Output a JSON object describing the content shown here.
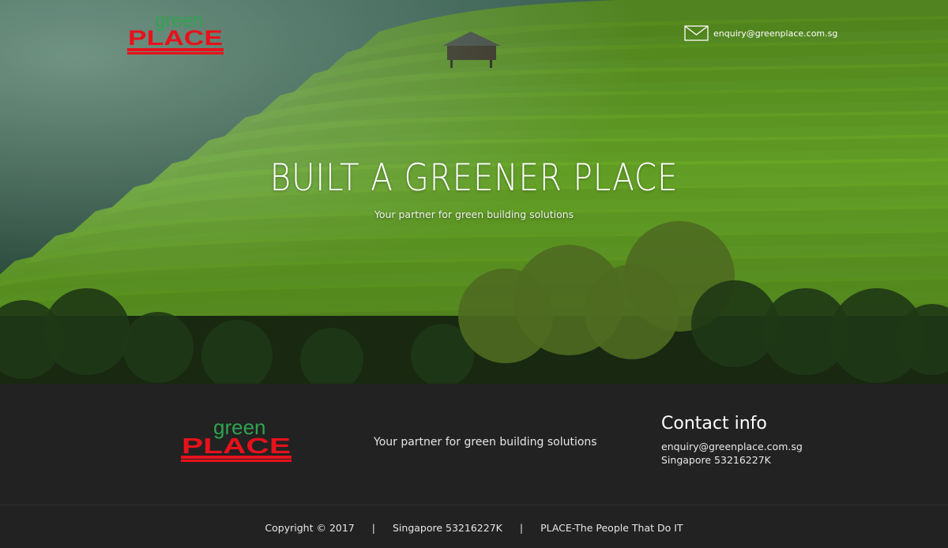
{
  "brand": {
    "logo_word_top": "green",
    "logo_word_bottom": "PLACE",
    "logo_green": "#2ea44f",
    "logo_red": "#e8111b"
  },
  "header": {
    "email_icon": "envelope-icon",
    "email": "enquiry@greenplace.com.sg"
  },
  "hero": {
    "headline": "BUILT A GREENER PLACE",
    "tagline": "Your partner for green building solutions"
  },
  "footer": {
    "tagline": "Your partner for green building solutions",
    "contact_title": "Contact info",
    "contact_email": "enquiry@greenplace.com.sg",
    "contact_phone": "Singapore 53216227K"
  },
  "bottom_bar": {
    "copyright": "Copyright © 2017",
    "separator": "|",
    "registration": "Singapore 53216227K",
    "slogan": "PLACE-The People That Do IT"
  },
  "colors": {
    "footer_bg": "#222222",
    "text": "#ffffff"
  }
}
